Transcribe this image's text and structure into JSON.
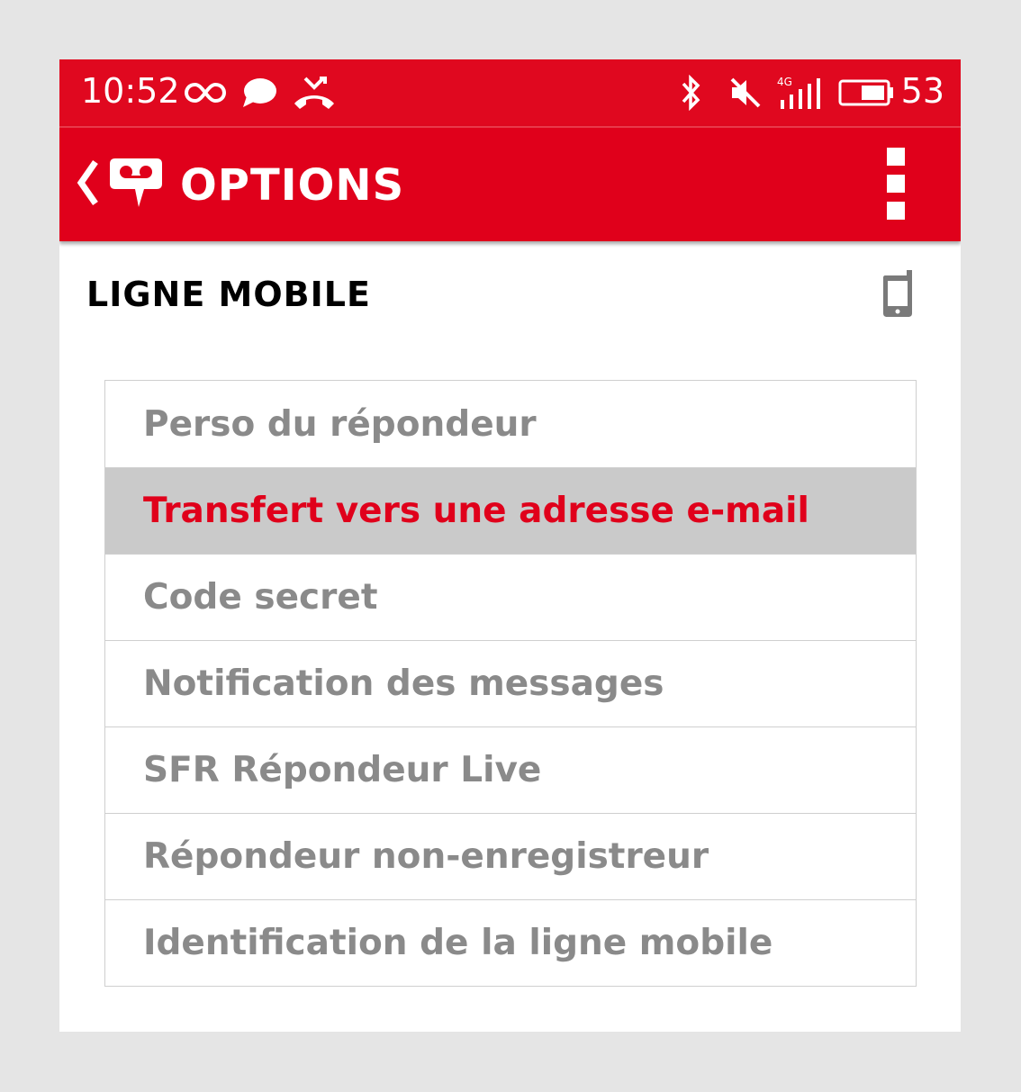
{
  "status_bar": {
    "time": "10:52",
    "battery_percent": "53",
    "network_type": "4G",
    "icons": [
      "infinity-icon",
      "chat-bubble-icon",
      "missed-call-icon",
      "bluetooth-icon",
      "mute-icon",
      "signal-icon",
      "battery-icon"
    ]
  },
  "app_bar": {
    "title": "OPTIONS",
    "back_icon": "chevron-left-icon",
    "logo_icon": "voicemail-logo-icon",
    "menu_icon": "overflow-menu-icon"
  },
  "section": {
    "title": "LIGNE MOBILE",
    "icon": "mobile-phone-icon"
  },
  "menu": {
    "items": [
      {
        "label": "Perso du répondeur",
        "selected": false
      },
      {
        "label": "Transfert vers une adresse e-mail",
        "selected": true
      },
      {
        "label": "Code secret",
        "selected": false
      },
      {
        "label": "Notification des messages",
        "selected": false
      },
      {
        "label": "SFR Répondeur Live",
        "selected": false
      },
      {
        "label": "Répondeur non-enregistreur",
        "selected": false
      },
      {
        "label": "Identification de la ligne mobile",
        "selected": false
      }
    ]
  },
  "colors": {
    "brand_red": "#e0001b",
    "item_text": "#8a8a8a",
    "selected_bg": "#cacaca"
  }
}
